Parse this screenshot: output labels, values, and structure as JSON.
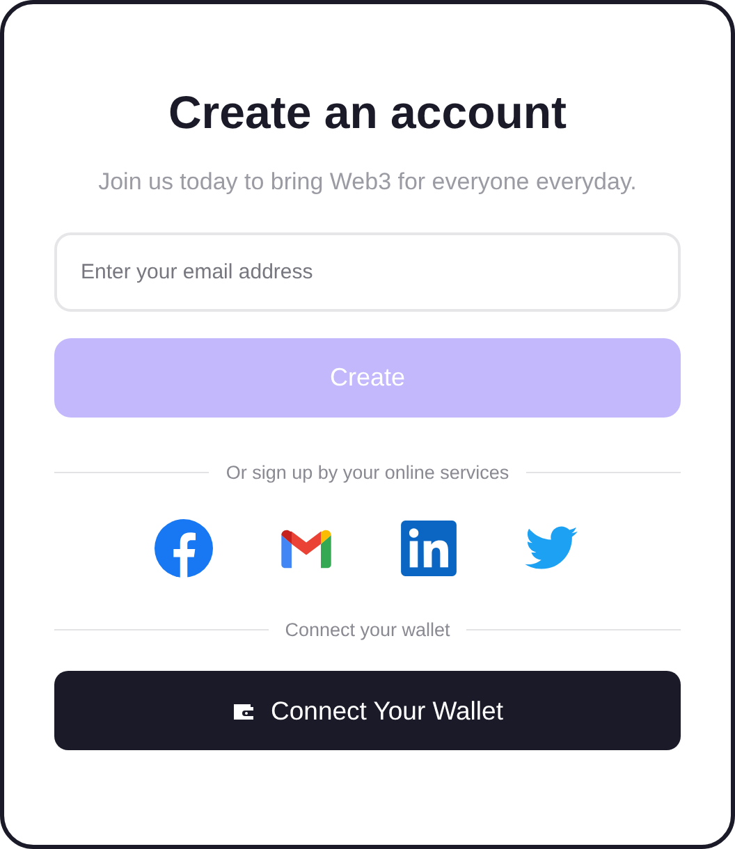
{
  "title": "Create an account",
  "subtitle": "Join us today to bring Web3 for everyone everyday.",
  "email": {
    "placeholder": "Enter your email address"
  },
  "create_button": {
    "label": "Create",
    "disabled": true
  },
  "social_divider": "Or sign up by your online services",
  "social": [
    {
      "kind": "facebook"
    },
    {
      "kind": "gmail"
    },
    {
      "kind": "linkedin"
    },
    {
      "kind": "twitter"
    }
  ],
  "wallet_divider": "Connect your wallet",
  "wallet_button": {
    "label": "Connect Your Wallet"
  }
}
